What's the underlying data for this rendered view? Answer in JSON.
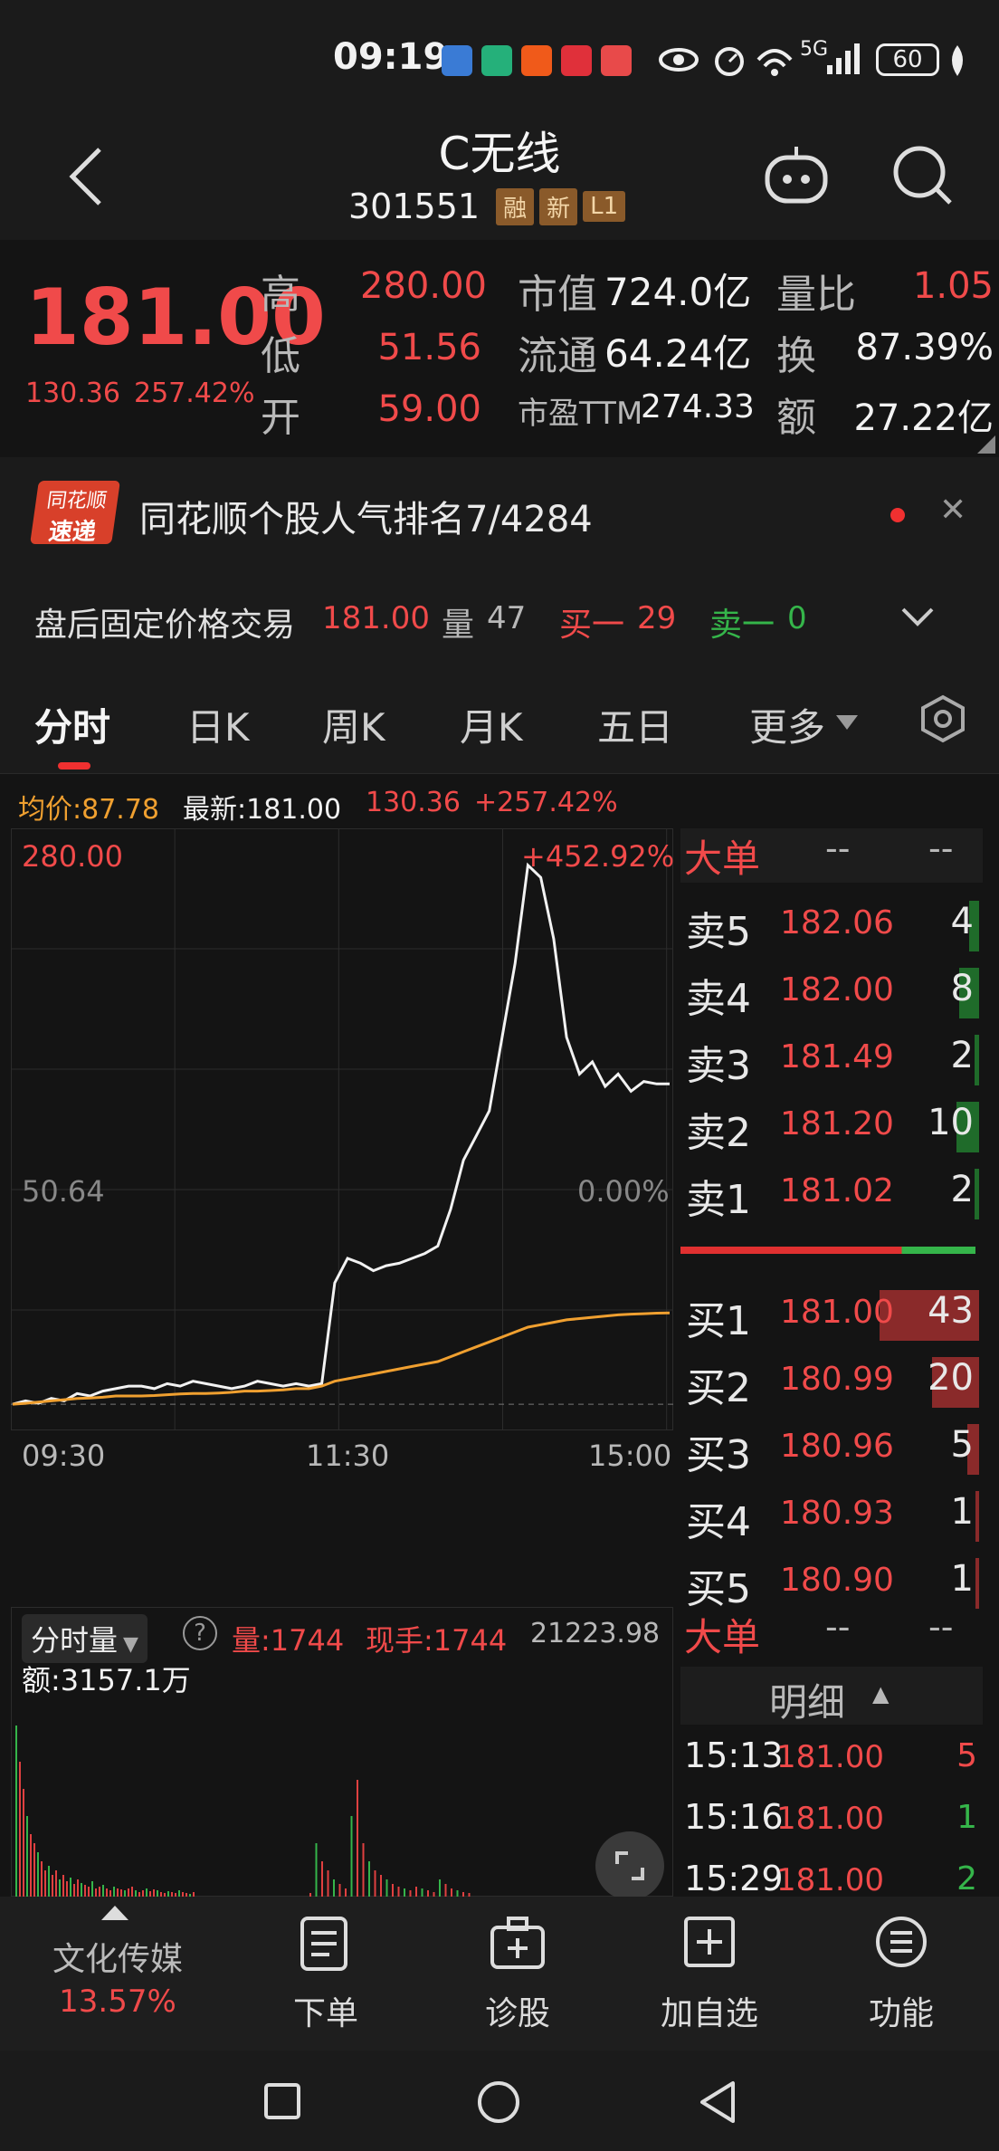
{
  "status_bar": {
    "time": "09:19",
    "battery": "60",
    "signal": "5G"
  },
  "header": {
    "title": "C无线",
    "code": "301551",
    "tags": [
      "融",
      "新",
      "L1"
    ]
  },
  "quote": {
    "price": "181.00",
    "change": "130.36",
    "change_pct": "257.42%",
    "high_label": "高",
    "high": "280.00",
    "low_label": "低",
    "low": "51.56",
    "open_label": "开",
    "open": "59.00",
    "mcap_label": "市值",
    "mcap": "724.0亿",
    "float_label": "流通",
    "float": "64.24亿",
    "pe_label": "市盈TTM",
    "pe": "274.33",
    "vr_label": "量比",
    "vr": "1.05",
    "turn_label": "换",
    "turn": "87.39%",
    "amt_label": "额",
    "amt": "27.22亿"
  },
  "rank": {
    "logo_top": "同花顺",
    "logo_bottom": "速递",
    "text": "同花顺个股人气排名7/4284"
  },
  "afterhours": {
    "label": "盘后固定价格交易",
    "price": "181.00",
    "vol_label": "量",
    "vol": "47",
    "buy_label": "买一",
    "buy": "29",
    "sell_label": "卖一",
    "sell": "0"
  },
  "tabs": [
    "分时",
    "日K",
    "周K",
    "月K",
    "五日",
    "更多"
  ],
  "chart_info": {
    "avg_label": "均价:87.78",
    "latest_label": "最新:181.00",
    "change": "130.36",
    "change_pct": "+257.42%"
  },
  "chart_data": {
    "type": "line",
    "y_top_label": "280.00",
    "y_base_label": "50.64",
    "pct_top_label": "+452.92%",
    "pct_base_label": "0.00%",
    "x_labels": [
      "09:30",
      "11:30",
      "15:00"
    ],
    "ylim": [
      40,
      285
    ],
    "series": [
      {
        "values": [
          50.64,
          52,
          51,
          53,
          52,
          55,
          54,
          56,
          57,
          58,
          58,
          57,
          59,
          58,
          60,
          59,
          58,
          57,
          58,
          60,
          59,
          58,
          59,
          58,
          59,
          100,
          110,
          108,
          105,
          107,
          108,
          110,
          112,
          115,
          130,
          150,
          160,
          170,
          200,
          230,
          270,
          265,
          240,
          200,
          185,
          190,
          180,
          185,
          178,
          182,
          181,
          181
        ]
      },
      {
        "values": [
          50.64,
          51,
          51.5,
          52,
          52.5,
          53,
          53.2,
          53.5,
          54,
          54,
          54,
          54.2,
          54.5,
          54.8,
          55,
          55,
          55.2,
          55.5,
          56,
          56,
          56.2,
          56.5,
          57,
          57,
          58,
          60,
          61,
          62,
          63,
          64,
          65,
          66,
          67,
          68,
          70,
          72,
          74,
          76,
          78,
          80,
          82,
          83,
          84,
          85,
          85.5,
          86,
          86.5,
          87,
          87.3,
          87.5,
          87.7,
          87.78
        ]
      }
    ]
  },
  "orderbook": {
    "big_order_label": "大单",
    "big_order_v1": "--",
    "big_order_v2": "--",
    "asks": [
      {
        "label": "卖5",
        "price": "182.06",
        "vol": "4",
        "share": 0.1
      },
      {
        "label": "卖4",
        "price": "182.00",
        "vol": "8",
        "share": 0.2
      },
      {
        "label": "卖3",
        "price": "181.49",
        "vol": "2",
        "share": 0.05
      },
      {
        "label": "卖2",
        "price": "181.20",
        "vol": "10",
        "share": 0.23
      },
      {
        "label": "卖1",
        "price": "181.02",
        "vol": "2",
        "share": 0.05
      }
    ],
    "bids": [
      {
        "label": "买1",
        "price": "181.00",
        "vol": "43",
        "share": 1.0
      },
      {
        "label": "买2",
        "price": "180.99",
        "vol": "20",
        "share": 0.47
      },
      {
        "label": "买3",
        "price": "180.96",
        "vol": "5",
        "share": 0.12
      },
      {
        "label": "买4",
        "price": "180.93",
        "vol": "1",
        "share": 0.03
      },
      {
        "label": "买5",
        "price": "180.90",
        "vol": "1",
        "share": 0.03
      }
    ],
    "split_ratio": 0.75
  },
  "volume_panel": {
    "dropdown": "分时量",
    "vol": "量:1744",
    "cur": "现手:1744",
    "max": "21223.98",
    "amount": "额:3157.1万"
  },
  "details": {
    "big_order_label": "大单",
    "v1": "--",
    "v2": "--",
    "title": "明细",
    "rows": [
      {
        "time": "15:13",
        "price": "181.00",
        "vol": "5",
        "dir": "red"
      },
      {
        "time": "15:16",
        "price": "181.00",
        "vol": "1",
        "dir": "green"
      },
      {
        "time": "15:29",
        "price": "181.00",
        "vol": "2",
        "dir": "green"
      }
    ]
  },
  "bottom_bar": {
    "sector": "文化传媒",
    "sector_pct": "13.57%",
    "items": [
      "下单",
      "诊股",
      "加自选",
      "功能"
    ]
  }
}
